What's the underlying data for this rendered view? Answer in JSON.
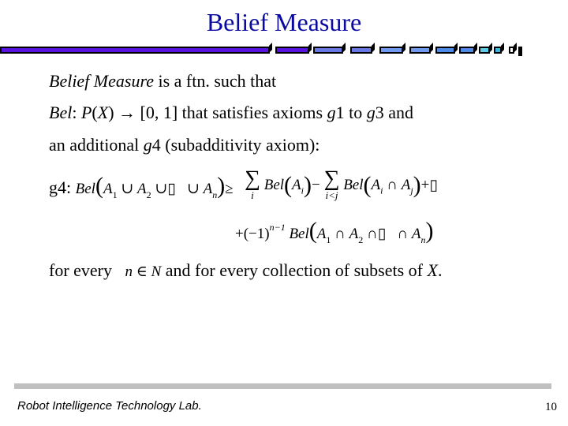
{
  "slide": {
    "title": "Belief Measure",
    "title_color": "#0a0aa0",
    "lines": {
      "l1_italic": "Belief  Measure",
      "l1_rest": " is a ftn. such that",
      "l2_bel": "Bel",
      "l2_colon": ": ",
      "l2_p": "P",
      "l2_paren_open": "(",
      "l2_x": "X",
      "l2_paren_close": ")",
      "l2_arrow": " → ",
      "l2_rest1": "[0, 1]  that satisfies axioms ",
      "l2_g1": "g",
      "l2_n1": "1 to ",
      "l2_g3": "g",
      "l2_n3": "3 and",
      "l3_pre": "an additional ",
      "l3_g": "g",
      "l3_post": "4 (subadditivity axiom):"
    },
    "formula": {
      "label": "g4:",
      "lhs": "Bel",
      "A": "A",
      "one": "1",
      "two": "2",
      "n": "n",
      "i": "i",
      "j": "j",
      "cup": "∪",
      "cap": "∩",
      "box": "▯",
      "geq": "≥",
      "sigma": "∑",
      "lim_i": "i",
      "lim_ij": "i<j",
      "minus": "−",
      "plus": "+",
      "neg_one": "(−1)",
      "exp": "n−1",
      "lp": "(",
      "rp": ")"
    },
    "last_line": {
      "pre": "for every",
      "n": "n",
      "in": " ∈ ",
      "N": "N",
      "post": " and for every collection of subsets of ",
      "X": "X",
      "end": "."
    },
    "footer": {
      "lab": "Robot Intelligence Technology Lab.",
      "page": "10"
    },
    "deco_colors": [
      "#5a12e0",
      "#5a12e0",
      "#6a78e6",
      "#6a78e6",
      "#6f9af0",
      "#6f9af0",
      "#4e8ae8",
      "#4e8ae8",
      "#5ccbe8",
      "#3cb8e0",
      "#ffffff",
      "#000000"
    ]
  }
}
